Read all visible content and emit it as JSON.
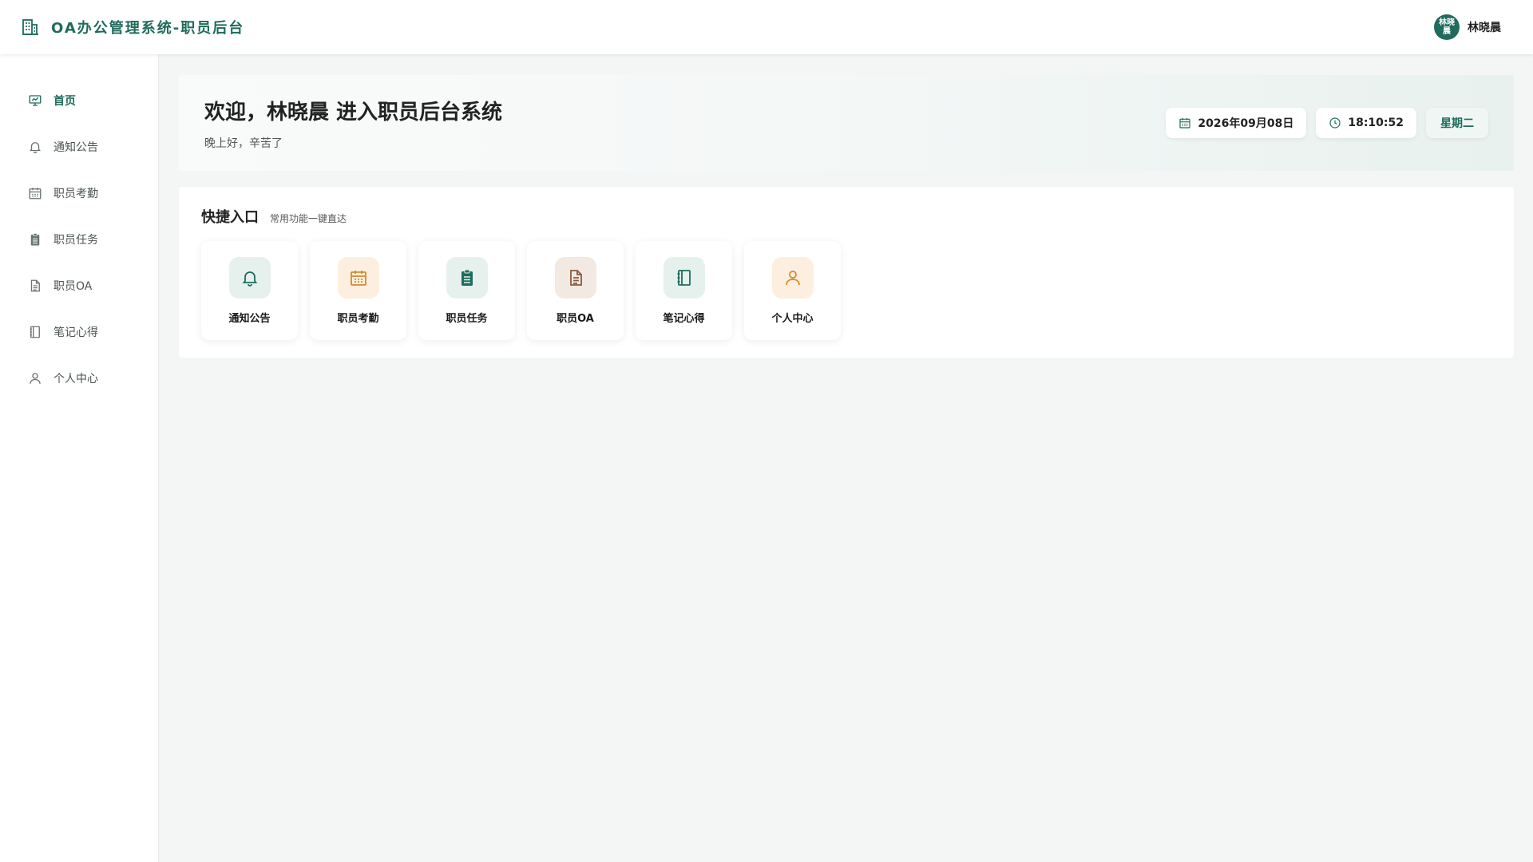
{
  "header": {
    "title": "OA办公管理系统-职员后台",
    "brand_icon": "building-icon",
    "avatar_text": "林晓晨",
    "user_name": "林晓晨"
  },
  "sidebar": {
    "items": [
      {
        "label": "首页",
        "icon": "home-chart-icon",
        "active": true
      },
      {
        "label": "通知公告",
        "icon": "bell-icon",
        "active": false
      },
      {
        "label": "职员考勤",
        "icon": "calendar-icon",
        "active": false
      },
      {
        "label": "职员任务",
        "icon": "clipboard-icon",
        "active": false
      },
      {
        "label": "职员OA",
        "icon": "document-icon",
        "active": false
      },
      {
        "label": "笔记心得",
        "icon": "notebook-icon",
        "active": false
      },
      {
        "label": "个人中心",
        "icon": "user-icon",
        "active": false
      }
    ]
  },
  "welcome": {
    "title": "欢迎，林晓晨 进入职员后台系统",
    "subtitle": "晚上好，辛苦了",
    "date": "2026年09月08日",
    "time": "18:10:52",
    "weekday": "星期二"
  },
  "quick": {
    "title": "快捷入口",
    "subtitle": "常用功能一键直达",
    "cards": [
      {
        "label": "通知公告",
        "icon": "bell-icon",
        "tint": "green"
      },
      {
        "label": "职员考勤",
        "icon": "calendar-icon",
        "tint": "orange"
      },
      {
        "label": "职员任务",
        "icon": "clipboard-icon",
        "tint": "green"
      },
      {
        "label": "职员OA",
        "icon": "document-icon",
        "tint": "brown"
      },
      {
        "label": "笔记心得",
        "icon": "notebook-icon",
        "tint": "green"
      },
      {
        "label": "个人中心",
        "icon": "user-icon",
        "tint": "orange"
      }
    ]
  },
  "colors": {
    "primary": "#1f6b5c",
    "background": "#f4f6f5",
    "orange_tint": "#fdefe0",
    "green_tint": "#e6f1ee",
    "brown_tint": "#f3e9e3"
  }
}
